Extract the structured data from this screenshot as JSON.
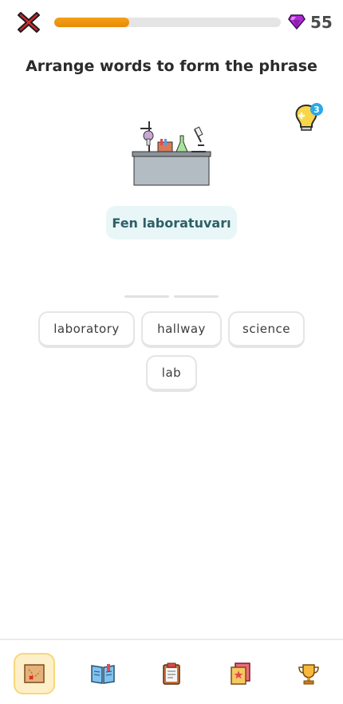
{
  "header": {
    "close_icon": "close-x-icon",
    "progress_fraction": 0.33,
    "accent_color": "#e88a06",
    "gem_icon": "gem-icon",
    "gem_count": "55"
  },
  "prompt": {
    "title": "Arrange words to form the phrase"
  },
  "hint": {
    "icon": "lightbulb-icon",
    "badge": "3"
  },
  "illustration": {
    "icon": "laboratory-bench-illustration"
  },
  "source": {
    "text": "Fen laboratuvarı"
  },
  "answer_slots": 2,
  "word_bank": [
    {
      "label": "laboratory"
    },
    {
      "label": "hallway"
    },
    {
      "label": "science"
    },
    {
      "label": "lab"
    }
  ],
  "bottom_nav": [
    {
      "icon": "map-icon",
      "active": true
    },
    {
      "icon": "book-icon",
      "active": false
    },
    {
      "icon": "clipboard-icon",
      "active": false
    },
    {
      "icon": "flashcards-icon",
      "active": false
    },
    {
      "icon": "trophy-icon",
      "active": false
    }
  ]
}
